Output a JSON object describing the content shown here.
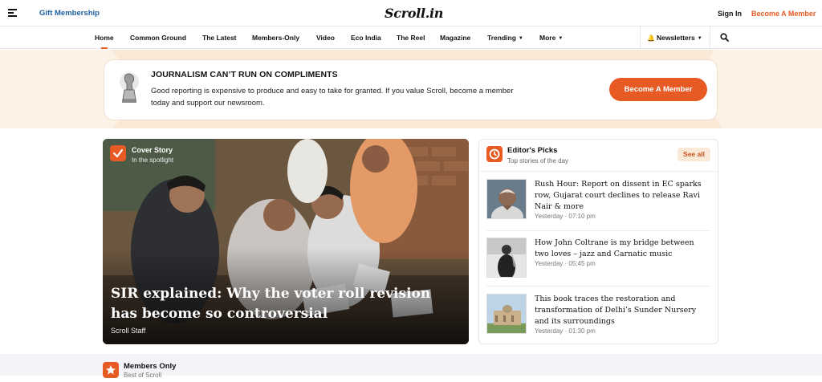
{
  "header": {
    "gift_label": "Gift Membership",
    "logo_text": "Scroll.in",
    "signin_label": "Sign In",
    "become_member_label": "Become A Member"
  },
  "nav": {
    "items": [
      {
        "label": "Home",
        "active": true
      },
      {
        "label": "Common Ground"
      },
      {
        "label": "The Latest"
      },
      {
        "label": "Members-Only"
      },
      {
        "label": "Video"
      },
      {
        "label": "Eco India"
      },
      {
        "label": "The Reel"
      },
      {
        "label": "Magazine"
      },
      {
        "label": "Trending",
        "dropdown": true
      },
      {
        "label": "More",
        "dropdown": true
      }
    ],
    "newsletters_label": "Newsletters"
  },
  "banner": {
    "title": "JOURNALISM CAN’T RUN ON COMPLIMENTS",
    "text": "Good reporting is expensive to produce and easy to take for granted. If you value Scroll, become a member today and support our newsroom.",
    "button_label": "Become A Member"
  },
  "cover_story": {
    "label": "Cover Story",
    "sublabel": "In the spotlight",
    "headline": "SIR explained: Why the voter roll revision has become so controversial",
    "author": "Scroll Staff"
  },
  "editors_picks": {
    "title": "Editor's Picks",
    "subtitle": "Top stories of the day",
    "see_all_label": "See all",
    "stories": [
      {
        "title": "Rush Hour: Report on dissent in EC sparks row, Gujarat court declines to release Ravi Nair & more",
        "time": "Yesterday · 07:10 pm"
      },
      {
        "title": "How John Coltrane is my bridge between two loves – jazz and Carnatic music",
        "time": "Yesterday · 05:45 pm"
      },
      {
        "title": "This book traces the restoration and transformation of Delhi’s Sunder Nursery and its surroundings",
        "time": "Yesterday · 01:30 pm"
      }
    ]
  },
  "members_only": {
    "title": "Members Only",
    "subtitle": "Best of Scroll"
  },
  "colors": {
    "accent": "#e85a24",
    "gift_link": "#1f5fa0",
    "banner_bg": "#fbe9d8",
    "members_band": "#f3f4f8"
  },
  "icons": [
    "menu-icon",
    "search-icon",
    "bell-icon",
    "check-icon",
    "clock-icon",
    "star-icon"
  ]
}
